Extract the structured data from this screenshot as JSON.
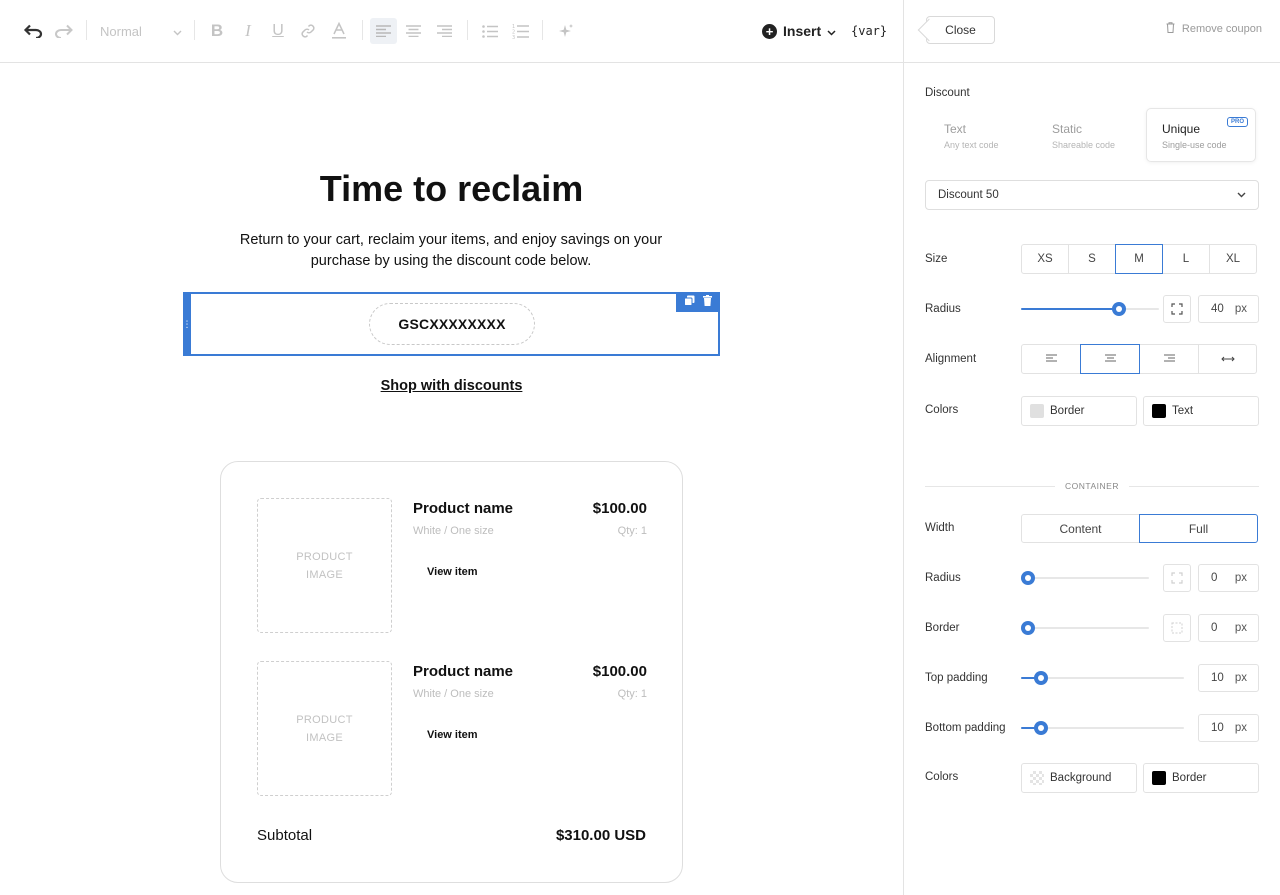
{
  "toolbar": {
    "style_select": "Normal",
    "insert_label": "Insert",
    "var_label": "{var}"
  },
  "email": {
    "title": "Time to reclaim",
    "subtitle": "Return to your cart, reclaim your items, and enjoy savings on your purchase by using the discount code below.",
    "coupon_code": "GSCXXXXXXXX",
    "shop_link": "Shop with discounts",
    "products": [
      {
        "image_placeholder_line1": "PRODUCT",
        "image_placeholder_line2": "IMAGE",
        "name": "Product name",
        "price": "$100.00",
        "variant": "White / One size",
        "qty": "Qty: 1",
        "view": "View item"
      },
      {
        "image_placeholder_line1": "PRODUCT",
        "image_placeholder_line2": "IMAGE",
        "name": "Product name",
        "price": "$100.00",
        "variant": "White / One size",
        "qty": "Qty: 1",
        "view": "View item"
      }
    ],
    "subtotal_label": "Subtotal",
    "subtotal_value": "$310.00 USD"
  },
  "panel": {
    "close_label": "Close",
    "remove_label": "Remove coupon",
    "discount_label": "Discount",
    "discount_types": [
      {
        "title": "Text",
        "sub": "Any text code"
      },
      {
        "title": "Static",
        "sub": "Shareable code"
      },
      {
        "title": "Unique",
        "sub": "Single-use code",
        "badge": "PRO"
      }
    ],
    "discount_selected": "Discount 50",
    "size_label": "Size",
    "sizes": [
      "XS",
      "S",
      "M",
      "L",
      "XL"
    ],
    "size_selected": "M",
    "radius_label": "Radius",
    "radius_value": "40",
    "radius_fraction": 0.7,
    "unit": "px",
    "alignment_label": "Alignment",
    "colors_label": "Colors",
    "border_label": "Border",
    "text_label": "Text",
    "container_label": "CONTAINER",
    "width_label": "Width",
    "width_content": "Content",
    "width_full": "Full",
    "c_radius_label": "Radius",
    "c_radius_value": "0",
    "c_border_label": "Border",
    "c_border_value": "0",
    "top_padding_label": "Top padding",
    "top_padding_value": "10",
    "bottom_padding_label": "Bottom padding",
    "bottom_padding_value": "10",
    "c_colors_label": "Colors",
    "background_label": "Background",
    "c_border_color_label": "Border"
  },
  "colors": {
    "accent": "#3a7bd5",
    "text_swatch": "#000000",
    "border_swatch": "#e0e0e0",
    "container_border_swatch": "#000000"
  }
}
